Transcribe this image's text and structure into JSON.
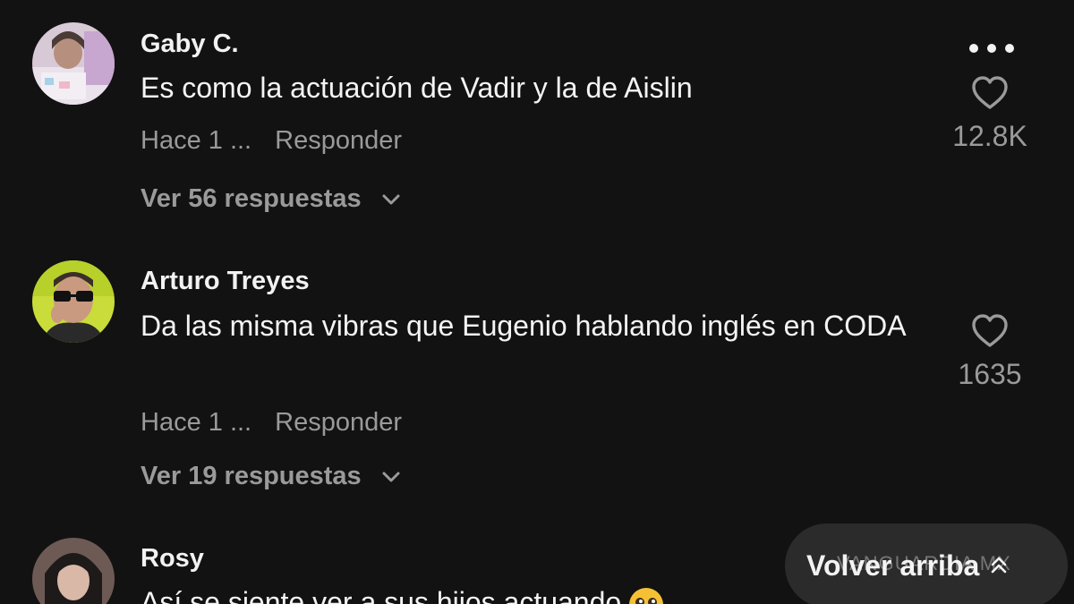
{
  "comments": [
    {
      "username": "Gaby C.",
      "text": "Es como la actuación de Vadir y la de Aislin",
      "time": "Hace 1 ...",
      "reply_label": "Responder",
      "replies_label": "Ver 56 respuestas",
      "likes": "12.8K"
    },
    {
      "username": "Arturo Treyes",
      "text": "Da las misma vibras que Eugenio hablando inglés en CODA",
      "time": "Hace 1 ...",
      "reply_label": "Responder",
      "replies_label": "Ver 19 respuestas",
      "likes": "1635"
    },
    {
      "username": "Rosy",
      "text": "Así se siente ver a sus hijos actuando"
    }
  ],
  "scroll_top": {
    "label": "Volver arriba"
  },
  "watermark": "VANGUARDIA MX",
  "icons": {
    "more": "more-options-icon",
    "like": "heart-icon",
    "expand": "chevron-down-icon",
    "scroll_up": "double-chevron-up-icon",
    "emoji": "pleading-face-emoji"
  },
  "colors": {
    "background": "#121212",
    "primary_text": "#f4f4f4",
    "secondary_text": "#9a9a9a",
    "pill": "#2b2b2b"
  }
}
